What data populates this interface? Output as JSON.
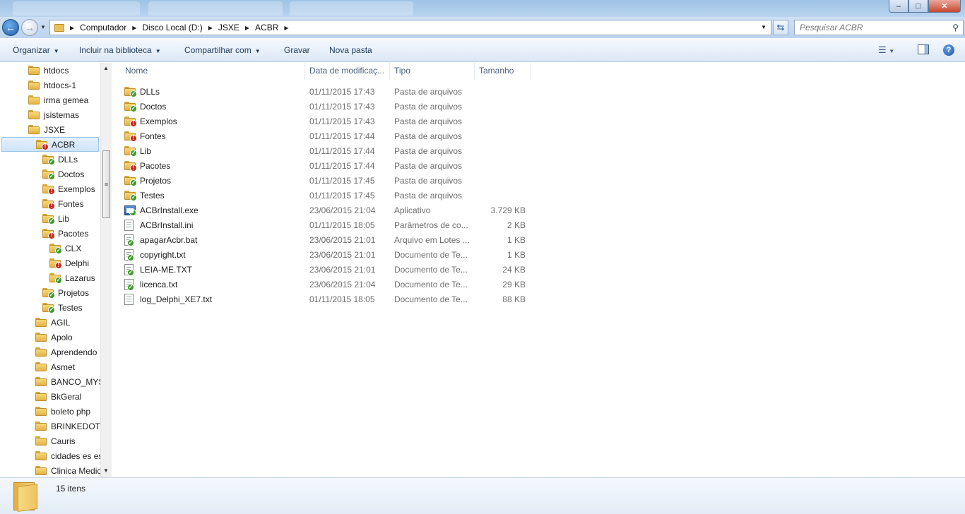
{
  "window": {
    "minimize_glyph": "–",
    "maximize_glyph": "□",
    "close_glyph": "✕"
  },
  "address": {
    "crumbs": [
      "Computador",
      "Disco Local (D:)",
      "JSXE",
      "ACBR"
    ],
    "search_placeholder": "Pesquisar ACBR"
  },
  "toolbar": {
    "organize": "Organizar",
    "include_library": "Incluir na biblioteca",
    "share_with": "Compartilhar com",
    "burn": "Gravar",
    "new_folder": "Nova pasta"
  },
  "tree": [
    {
      "label": "htdocs",
      "indent": 0,
      "status": "none"
    },
    {
      "label": "htdocs-1",
      "indent": 0,
      "status": "none"
    },
    {
      "label": "irma gemea",
      "indent": 0,
      "status": "none"
    },
    {
      "label": "jsistemas",
      "indent": 0,
      "status": "none"
    },
    {
      "label": "JSXE",
      "indent": 0,
      "status": "none"
    },
    {
      "label": "ACBR",
      "indent": 1,
      "status": "err",
      "selected": true
    },
    {
      "label": "DLLs",
      "indent": 2,
      "status": "ok"
    },
    {
      "label": "Doctos",
      "indent": 2,
      "status": "ok"
    },
    {
      "label": "Exemplos",
      "indent": 2,
      "status": "err"
    },
    {
      "label": "Fontes",
      "indent": 2,
      "status": "err"
    },
    {
      "label": "Lib",
      "indent": 2,
      "status": "ok"
    },
    {
      "label": "Pacotes",
      "indent": 2,
      "status": "err"
    },
    {
      "label": "CLX",
      "indent": 3,
      "status": "ok"
    },
    {
      "label": "Delphi",
      "indent": 3,
      "status": "err"
    },
    {
      "label": "Lazarus",
      "indent": 3,
      "status": "ok"
    },
    {
      "label": "Projetos",
      "indent": 2,
      "status": "ok"
    },
    {
      "label": "Testes",
      "indent": 2,
      "status": "ok"
    },
    {
      "label": "AGIL",
      "indent": 1,
      "status": "none"
    },
    {
      "label": "Apolo",
      "indent": 1,
      "status": "none"
    },
    {
      "label": "Aprendendo",
      "indent": 1,
      "status": "none"
    },
    {
      "label": "Asmet",
      "indent": 1,
      "status": "none"
    },
    {
      "label": "BANCO_MYS",
      "indent": 1,
      "status": "none"
    },
    {
      "label": "BkGeral",
      "indent": 1,
      "status": "none"
    },
    {
      "label": "boleto php",
      "indent": 1,
      "status": "none"
    },
    {
      "label": "BRINKEDOTE",
      "indent": 1,
      "status": "none"
    },
    {
      "label": "Cauris",
      "indent": 1,
      "status": "none"
    },
    {
      "label": "cidades es es",
      "indent": 1,
      "status": "none"
    },
    {
      "label": "Clinica Medic",
      "indent": 1,
      "status": "none"
    }
  ],
  "columns": {
    "name": "Nome",
    "modified": "Data de modificaç...",
    "type": "Tipo",
    "size": "Tamanho"
  },
  "files": [
    {
      "name": "DLLs",
      "date": "01/11/2015 17:43",
      "type": "Pasta de arquivos",
      "size": "",
      "icon": "folder",
      "status": "ok"
    },
    {
      "name": "Doctos",
      "date": "01/11/2015 17:43",
      "type": "Pasta de arquivos",
      "size": "",
      "icon": "folder",
      "status": "ok"
    },
    {
      "name": "Exemplos",
      "date": "01/11/2015 17:43",
      "type": "Pasta de arquivos",
      "size": "",
      "icon": "folder",
      "status": "err"
    },
    {
      "name": "Fontes",
      "date": "01/11/2015 17:44",
      "type": "Pasta de arquivos",
      "size": "",
      "icon": "folder",
      "status": "err"
    },
    {
      "name": "Lib",
      "date": "01/11/2015 17:44",
      "type": "Pasta de arquivos",
      "size": "",
      "icon": "folder",
      "status": "ok"
    },
    {
      "name": "Pacotes",
      "date": "01/11/2015 17:44",
      "type": "Pasta de arquivos",
      "size": "",
      "icon": "folder",
      "status": "err"
    },
    {
      "name": "Projetos",
      "date": "01/11/2015 17:45",
      "type": "Pasta de arquivos",
      "size": "",
      "icon": "folder",
      "status": "ok"
    },
    {
      "name": "Testes",
      "date": "01/11/2015 17:45",
      "type": "Pasta de arquivos",
      "size": "",
      "icon": "folder",
      "status": "ok"
    },
    {
      "name": "ACBrInstall.exe",
      "date": "23/06/2015 21:04",
      "type": "Aplicativo",
      "size": "3.729 KB",
      "icon": "exe",
      "status": "ok"
    },
    {
      "name": "ACBrInstall.ini",
      "date": "01/11/2015 18:05",
      "type": "Parâmetros de co...",
      "size": "2 KB",
      "icon": "file",
      "status": "none"
    },
    {
      "name": "apagarAcbr.bat",
      "date": "23/06/2015 21:01",
      "type": "Arquivo em Lotes ...",
      "size": "1 KB",
      "icon": "file",
      "status": "ok"
    },
    {
      "name": "copyright.txt",
      "date": "23/06/2015 21:01",
      "type": "Documento de Te...",
      "size": "1 KB",
      "icon": "file",
      "status": "ok"
    },
    {
      "name": "LEIA-ME.TXT",
      "date": "23/06/2015 21:01",
      "type": "Documento de Te...",
      "size": "24 KB",
      "icon": "file",
      "status": "ok"
    },
    {
      "name": "licenca.txt",
      "date": "23/06/2015 21:04",
      "type": "Documento de Te...",
      "size": "29 KB",
      "icon": "file",
      "status": "ok"
    },
    {
      "name": "log_Delphi_XE7.txt",
      "date": "01/11/2015 18:05",
      "type": "Documento de Te...",
      "size": "88 KB",
      "icon": "file",
      "status": "none"
    }
  ],
  "status": {
    "item_count": "15 itens"
  }
}
